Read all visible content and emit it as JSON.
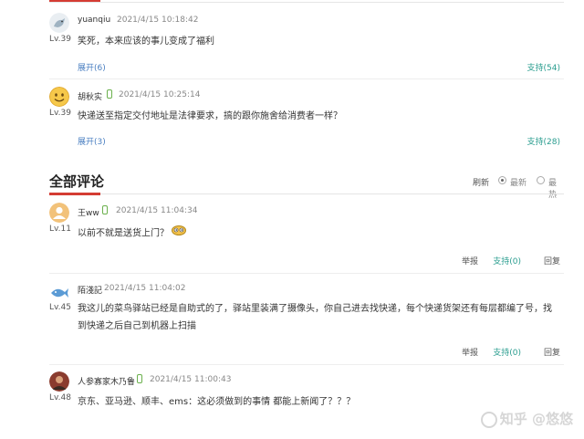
{
  "hot_comments": [
    {
      "username": "yuanqiu",
      "level": "Lv.39",
      "time": "2021/4/15 10:18:42",
      "text": "笑死，本来应该的事儿变成了福利",
      "expand": "展开(6)",
      "support": "支持(54)",
      "avatar_icon": "gray-bird-avatar-icon"
    },
    {
      "username": "胡秋实",
      "level": "Lv.39",
      "time": "2021/4/15 10:25:14",
      "text": "快递送至指定交付地址是法律要求，搞的跟你施舍给消费者一样？",
      "expand": "展开(3)",
      "support": "支持(28)",
      "avatar_icon": "smiley-face-avatar-icon"
    }
  ],
  "section": {
    "title": "全部评论",
    "sort_label": "刷新",
    "sort_newest": "最新",
    "sort_hottest": "最热"
  },
  "all_comments": [
    {
      "username": "王ww",
      "level": "Lv.11",
      "time": "2021/4/15 11:04:34",
      "text": "以前不就是送货上门？",
      "report": "举报",
      "support": "支持(0)",
      "reply": "回复"
    },
    {
      "username": "陌淺記",
      "level": "Lv.45",
      "time": "2021/4/15 11:04:02",
      "text": "我这儿的菜鸟驿站已经是自助式的了，驿站里装满了摄像头，你自己进去找快递，每个快递货架还有每层都编了号，找到快递之后自己到机器上扫描",
      "report": "举报",
      "support": "支持(0)",
      "reply": "回复"
    },
    {
      "username": "人参寡家木乃鲁",
      "level": "Lv.48",
      "time": "2021/4/15 11:00:43",
      "text": "京东、亚马逊、顺丰、ems：这必须做到的事情 都能上新闻了？？？"
    }
  ],
  "watermark": "知乎 @悠悠",
  "colors": {
    "accent_red": "#d43c33",
    "support_green": "#2a9d8f",
    "expand_blue": "#4a7fc1",
    "phone_green": "#6ab04c"
  }
}
